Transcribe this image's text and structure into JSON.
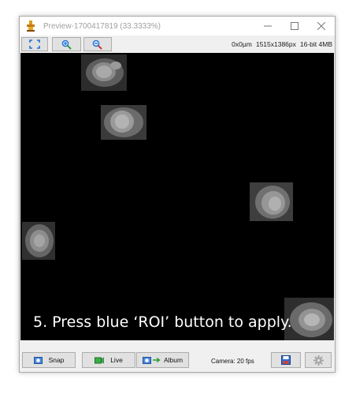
{
  "window": {
    "title": "Preview-1700417819 (33.3333%)"
  },
  "title_controls": [
    "minimize",
    "maximize",
    "close"
  ],
  "toolbar": {
    "buttons": [
      {
        "name": "fit-to-window",
        "icon": "fullscreen-icon"
      },
      {
        "name": "zoom-in",
        "icon": "zoom-in-icon"
      },
      {
        "name": "zoom-out",
        "icon": "zoom-out-icon"
      }
    ],
    "position": "0x0µm",
    "dimensions": "1515x1386px",
    "bit_depth": "16-bit 4MB"
  },
  "viewport": {
    "overlay_text": "5. Press blue ‘ROI’ button to apply.",
    "image_content": "grayscale microscopy field with several cell nuclei on black background"
  },
  "bottom_bar": {
    "snap_label": "Snap",
    "live_label": "Live",
    "album_label": "Album",
    "camera_status": "Camera: 20 fps"
  },
  "colors": {
    "background": "#000000",
    "overlay_text": "#ffffff",
    "button_face": "#e1e1e1",
    "accent_blue": "#1f6fd1",
    "live_green": "#2e9e3a"
  }
}
